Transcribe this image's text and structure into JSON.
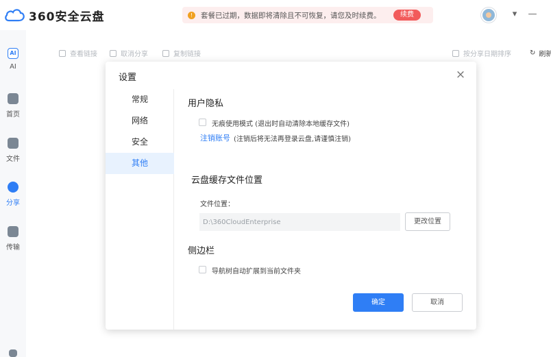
{
  "app": {
    "title": "360安全云盘"
  },
  "notice": {
    "text": "套餐已过期，数据即将清除且不可恢复，请您及时续费。",
    "renew_label": "续费"
  },
  "window": {
    "dropdown": "▾",
    "minimize": "—"
  },
  "sidebar": {
    "items": [
      {
        "label": "AI",
        "icon": "ai-icon",
        "badge": "AI"
      },
      {
        "label": "首页",
        "icon": "home-icon"
      },
      {
        "label": "文件",
        "icon": "folder-icon"
      },
      {
        "label": "分享",
        "icon": "share-icon",
        "active": true
      },
      {
        "label": "传输",
        "icon": "transfer-icon"
      }
    ]
  },
  "toolbar": {
    "view_link": "查看链接",
    "cancel_share": "取消分享",
    "copy_link": "复制链接",
    "sort_label": "按分享日期排序",
    "refresh_label": "刷新"
  },
  "dialog": {
    "title": "设置",
    "close": "×",
    "nav": [
      "常规",
      "网络",
      "安全",
      "其他"
    ],
    "active_nav": "其他",
    "privacy": {
      "title": "用户隐私",
      "incognito_label": "无痕使用模式 (退出时自动清除本地缓存文件)",
      "deregister_link": "注销账号",
      "deregister_note": "(注销后将无法再登录云盘,请谨慎注销)"
    },
    "cache": {
      "title": "云盘缓存文件位置",
      "location_label": "文件位置：",
      "path_value": "D:\\360CloudEnterprise",
      "change_button": "更改位置"
    },
    "sidebar_section": {
      "title": "侧边栏",
      "expand_label": "导航树自动扩展到当前文件夹"
    },
    "ok_button": "确定",
    "cancel_button": "取消"
  },
  "colors": {
    "accent": "#2f7ef5",
    "danger": "#f25b5b",
    "notice_bg": "#fdeeee"
  }
}
